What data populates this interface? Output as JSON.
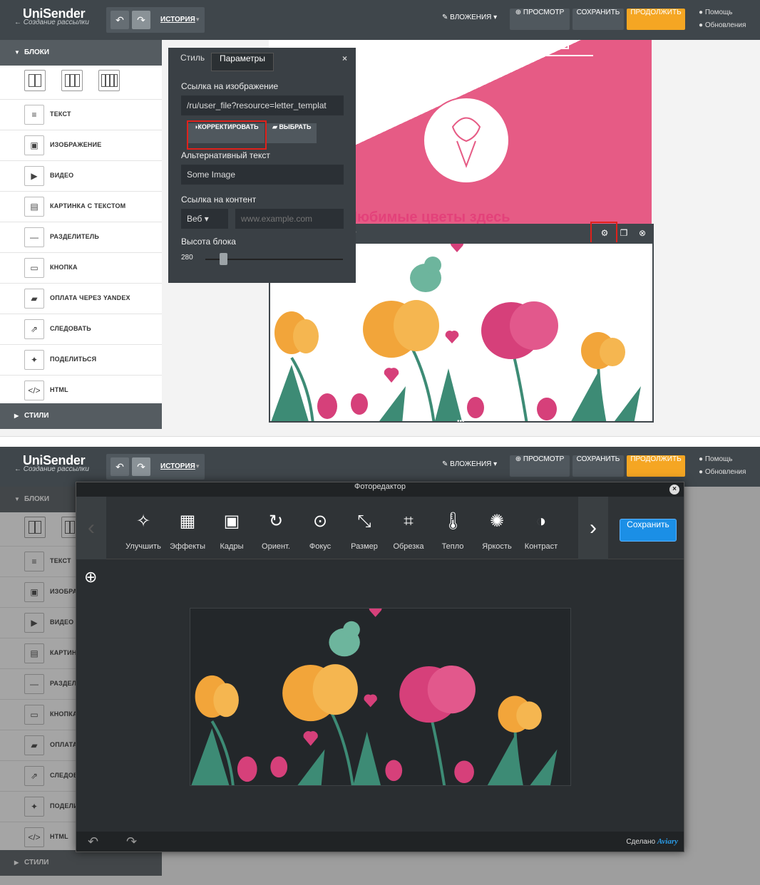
{
  "app": {
    "logo": "UniSender",
    "subtitle": "Создание рассылки"
  },
  "header": {
    "history_label": "ИСТОРИЯ",
    "attachments_label": "ВЛОЖЕНИЯ",
    "preview_label": "ПРОСМОТР",
    "save_label": "СОХРАНИТЬ",
    "continue_label": "ПРОДОЛЖИТЬ",
    "help_label": "Помощь",
    "updates_label": "Обновления"
  },
  "sidebar": {
    "blocks_title": "БЛОКИ",
    "styles_title": "СТИЛИ",
    "items": [
      {
        "label": "ТЕКСТ",
        "icon": "text-icon"
      },
      {
        "label": "ИЗОБРАЖЕНИЕ",
        "icon": "image-icon"
      },
      {
        "label": "ВИДЕО",
        "icon": "video-icon"
      },
      {
        "label": "КАРТИНКА С ТЕКСТОМ",
        "icon": "image-text-icon"
      },
      {
        "label": "РАЗДЕЛИТЕЛЬ",
        "icon": "divider-icon"
      },
      {
        "label": "КНОПКА",
        "icon": "button-icon"
      },
      {
        "label": "ОПЛАТА ЧЕРЕЗ YANDEX",
        "icon": "payment-icon"
      },
      {
        "label": "СЛЕДОВАТЬ",
        "icon": "share-icon"
      },
      {
        "label": "ПОДЕЛИТЬСЯ",
        "icon": "twitter-icon"
      },
      {
        "label": "HTML",
        "icon": "code-icon"
      }
    ],
    "items_clipped": [
      "ТЕКСТ",
      "ИЗОБРА",
      "ВИДЕО",
      "КАРТИН",
      "РАЗДЕЛ",
      "КНОПКА",
      "ОПЛАТА",
      "СЛЕДОВ",
      "ПОДЕЛИ",
      "HTML"
    ]
  },
  "panel": {
    "tab_style": "Стиль",
    "tab_params": "Параметры",
    "image_link_label": "Ссылка на изображение",
    "image_link_value": "/ru/user_file?resource=letter_templat",
    "edit_button": "КОРРЕКТИРОВАТЬ",
    "choose_button": "ВЫБРАТЬ",
    "alt_label": "Альтернативный текст",
    "alt_value": "Some Image",
    "content_link_label": "Ссылка на контент",
    "link_type": "Веб",
    "content_link_placeholder": "www.example.com",
    "height_label": "Высота блока",
    "height_value": "280",
    "close": "×"
  },
  "canvas": {
    "hero_title": "Любимые цветы здесь"
  },
  "editor": {
    "title": "Фоторедактор",
    "save": "Сохранить",
    "credit": "Сделано",
    "credit_brand": "Aviary",
    "tools": [
      {
        "label": "Улучшить",
        "icon": "magic-wand-icon"
      },
      {
        "label": "Эффекты",
        "icon": "effects-icon"
      },
      {
        "label": "Кадры",
        "icon": "frames-icon"
      },
      {
        "label": "Ориент.",
        "icon": "rotate-icon"
      },
      {
        "label": "Фокус",
        "icon": "focus-icon"
      },
      {
        "label": "Размер",
        "icon": "resize-icon"
      },
      {
        "label": "Обрезка",
        "icon": "crop-icon"
      },
      {
        "label": "Тепло",
        "icon": "thermometer-icon"
      },
      {
        "label": "Яркость",
        "icon": "brightness-icon"
      },
      {
        "label": "Контраст",
        "icon": "contrast-icon"
      }
    ]
  },
  "colors": {
    "accent": "#f5a623",
    "pink": "#e65b85",
    "blue": "#1b8fe6",
    "highlight": "#e0211b"
  }
}
